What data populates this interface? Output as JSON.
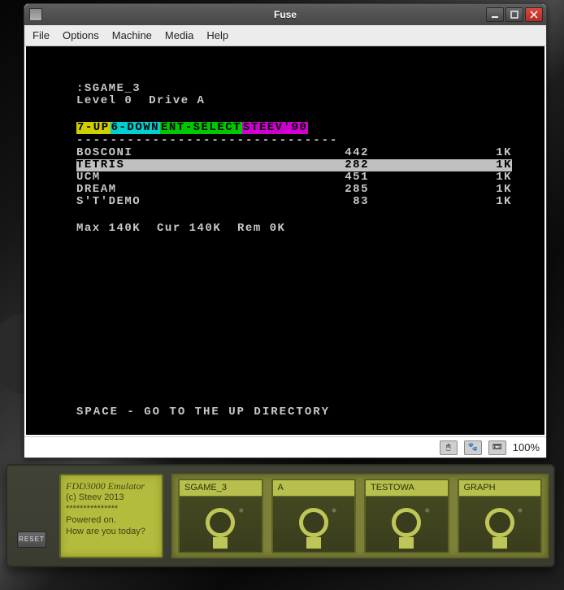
{
  "window": {
    "title": "Fuse",
    "menu": [
      "File",
      "Options",
      "Machine",
      "Media",
      "Help"
    ],
    "zoom": "100%"
  },
  "zx": {
    "prompt": ":SGAME_3",
    "level_line": "Level 0  Drive A",
    "nav": {
      "up": "7-UP ",
      "down": "6-DOWN ",
      "select": "ENT-SELECT ",
      "tag": "STEEV'90"
    },
    "dashes": "-------------------------------",
    "files": [
      {
        "name": "BOSCONI",
        "num": "442",
        "size": "1K",
        "selected": false
      },
      {
        "name": "TETRIS",
        "num": "282",
        "size": "1K",
        "selected": true
      },
      {
        "name": "UCM",
        "num": "451",
        "size": "1K",
        "selected": false
      },
      {
        "name": "DREAM",
        "num": "285",
        "size": "1K",
        "selected": false
      },
      {
        "name": "S'T'DEMO",
        "num": "83",
        "size": "1K",
        "selected": false
      }
    ],
    "status": "Max 140K  Cur 140K  Rem 0K",
    "footer": "SPACE - GO TO THE UP DIRECTORY"
  },
  "fdd": {
    "lcd": {
      "l1": "FDD3000 Emulator",
      "l2": "(c) Steev 2013",
      "l3": "***************",
      "l4": "Powered on.",
      "l5": "How are you today?"
    },
    "reset": "RESET",
    "drives": [
      "SGAME_3",
      "A",
      "TESTOWA",
      "GRAPH"
    ]
  }
}
